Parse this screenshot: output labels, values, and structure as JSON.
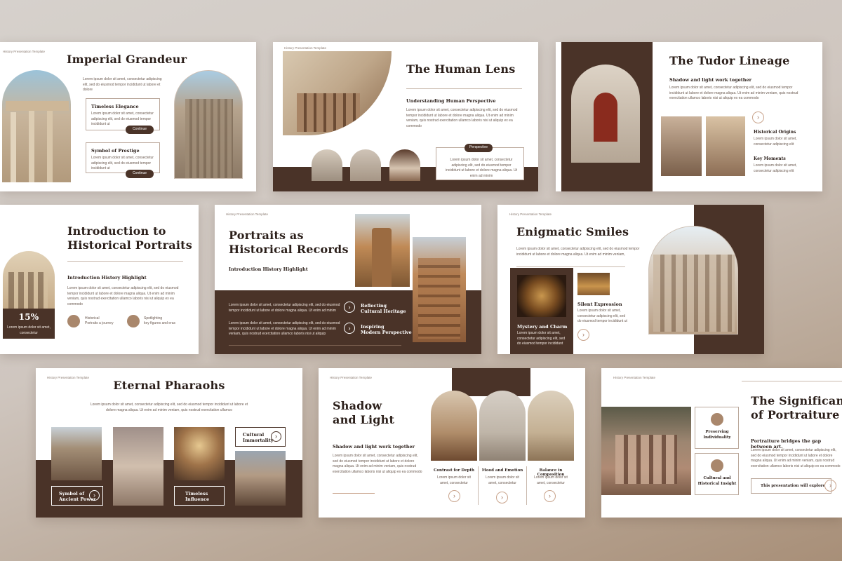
{
  "tag": "History Presentation Template",
  "s1": {
    "title": "Imperial Grandeur",
    "intro": "Lorem ipsum dolor sit amet, consectetur adipiscing elit, sed do eiusmod tempor incididunt ut labore et dolore",
    "card1_title": "Timeless Elegance",
    "card1_text": "Lorem ipsum dolor sit amet, consectetur adipiscing elit, sed do eiusmod tempor incididunt ut",
    "card2_title": "Symbol of Prestige",
    "card2_text": "Lorem ipsum dolor sit amet, consectetur adipiscing elit, sed do eiusmod tempor incididunt ut",
    "btn": "Continue"
  },
  "s2": {
    "title": "The Human Lens",
    "sub": "Understanding Human Perspective",
    "text": "Lorem ipsum dolor sit amet, consectetur adipiscing elit, sed do eiusmod tempor incididunt ut labore et dolore magna aliqua. Ut enim ad minim veniam, quis nostrud exercitation ullamco laboris nisi ut aliquip ex ea commodo",
    "pill": "Perspective",
    "box_text": "Lorem ipsum dolor sit amet, consectetur adipiscing elit, sed do eiusmod tempor incididunt ut labore et dolore magna aliqua. Ut enim ad minim"
  },
  "s3": {
    "title": "The Tudor Lineage",
    "sub": "Shadow and light work together",
    "text": "Lorem ipsum dolor sit amet, consectetur adipiscing elit, sed do eiusmod tempor incididunt ut labore et dolore magna aliqua. Ut enim ad minim veniam, quis nostrud exercitation ullamco laboris nisi ut aliquip ex ea commodo",
    "h1": "Historical Origins",
    "t1": "Lorem ipsum dolor sit amet, consectetur adipiscing elit",
    "h2": "Key Moments",
    "t2": "Lorem ipsum dolor sit amet, consectetur adipiscing elit"
  },
  "s4": {
    "title1": "Introduction to",
    "title2": "Historical Portraits",
    "sub": "Introduction History Highlight",
    "text": "Lorem ipsum dolor sit amet, consectetur adipiscing elit, sed do eiusmod tempor incididunt ut labore et dolore magna aliqua. Ut enim ad minim veniam, quis nostrud exercitation ullamco laboris nisi ut aliquip ex ea commodo",
    "stat": "15%",
    "stat_text": "Lorem ipsum dolor sit amet, consectetur",
    "i1a": "Historical",
    "i1b": "Portraits a journey",
    "i2a": "Spotlighting",
    "i2b": "key figures and eras"
  },
  "s5": {
    "title1": "Portraits as",
    "title2": "Historical Records",
    "sub": "Introduction History Highlight",
    "p1": "Lorem ipsum dolor sit amet, consectetur adipiscing elit, sed do eiusmod tempor incididunt ut labore et dolore magna aliqua. Ut enim ad minim",
    "p2": "Lorem ipsum dolor sit amet, consectetur adipiscing elit, sed do eiusmod tempor incididunt ut labore et dolore magna aliqua. Ut enim ad minim veniam, quis nostrud exercitation ullamco laboris nisi ut aliquip",
    "r1a": "Reflecting",
    "r1b": "Cultural Heritage",
    "r2a": "Inspiring",
    "r2b": "Modern Perspective"
  },
  "s6": {
    "title": "Enigmatic Smiles",
    "intro": "Lorem ipsum dolor sit amet, consectetur adipiscing elit, sed do eiusmod tempor incididunt ut labore et dolore magna aliqua. Ut enim ad minim veniam,",
    "h1": "Mystery and Charm",
    "t1": "Lorem ipsum dolor sit amet, consectetur adipiscing elit, sed do eiusmod tempor incididunt",
    "h2": "Silent Expression",
    "t2": "Lorem ipsum dolor sit amet, consectetur adipiscing elit, sed do eiusmod tempor incididunt ut"
  },
  "s7": {
    "title": "Eternal Pharaohs",
    "intro": "Lorem ipsum dolor sit amet, consectetur adipiscing elit, sed do eiusmod tempor incididunt ut labore et dolore magna aliqua. Ut enim ad minim veniam, quis nostrud exercitation ullamco",
    "c1": "Cultural",
    "c2": "Immortality",
    "b1a": "Symbol of",
    "b1b": "Ancient Power",
    "b2a": "Timeless",
    "b2b": "Influence"
  },
  "s8": {
    "title1": "Shadow",
    "title2": "and Light",
    "sub": "Shadow and light work together",
    "text": "Lorem ipsum dolor sit amet, consectetur adipiscing elit, sed do eiusmod tempor incididunt ut labore et dolore magna aliqua. Ut enim ad minim veniam, quis nostrud exercitation ullamco laboris nisi ut aliquip ex ea commodo",
    "c1": "Contrast for Depth",
    "c2": "Mood and Emotion",
    "c3": "Balance in Composition",
    "ct": "Lorem ipsum dolor sit amet, consectetur"
  },
  "s9": {
    "title1": "The Significance",
    "title2": "of Portraiture",
    "card1a": "Preserving",
    "card1b": "Individuality",
    "card2a": "Cultural and",
    "card2b": "Historical Insight",
    "sub": "Portraiture bridges the gap between art.",
    "text": "Lorem ipsum dolor sit amet, consectetur adipiscing elit, sed do eiusmod tempor incididunt ut labore et dolore magna aliqua. Ut enim ad minim veniam, quis nostrud exercitation ullamco laboris nisi ut aliquip ex ea commodo",
    "btn": "This presentation will explore"
  },
  "colors": {
    "brown": "#4a3328",
    "accent": "#c9a48c"
  }
}
